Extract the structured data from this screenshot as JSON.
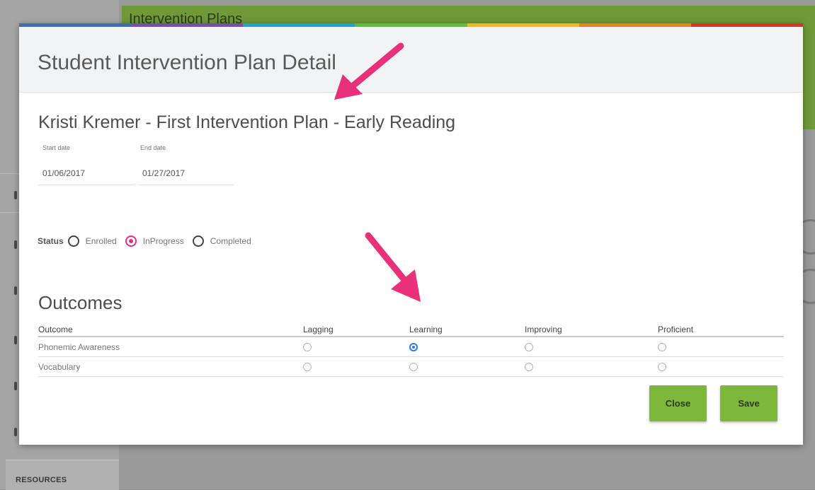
{
  "background": {
    "header_title": "Intervention Plans",
    "resources_label": "RESOURCES"
  },
  "modal": {
    "title": "Student Intervention Plan Detail",
    "color_bar": [
      "#3b6fb6",
      "#7b4bb0",
      "#1ea0d8",
      "#5bbf3a",
      "#f2b81c",
      "#f07f23",
      "#d9362b"
    ],
    "plan_title": "Kristi Kremer - First Intervention Plan - Early Reading",
    "start_date": {
      "label": "Start date",
      "value": "01/06/2017"
    },
    "end_date": {
      "label": "End date",
      "value": "01/27/2017"
    },
    "status": {
      "label": "Status",
      "options": [
        {
          "label": "Enrolled",
          "selected": false
        },
        {
          "label": "InProgress",
          "selected": true
        },
        {
          "label": "Completed",
          "selected": false
        }
      ]
    },
    "outcomes": {
      "title": "Outcomes",
      "columns": [
        "Outcome",
        "Lagging",
        "Learning",
        "Improving",
        "Proficient"
      ],
      "rows": [
        {
          "name": "Phonemic Awareness",
          "selected": "Learning"
        },
        {
          "name": "Vocabulary",
          "selected": ""
        }
      ]
    },
    "buttons": {
      "close": "Close",
      "save": "Save"
    }
  },
  "colors": {
    "accent_green": "#7db83a",
    "arrow_pink": "#e8317a",
    "radio_blue": "#2a7de0"
  }
}
